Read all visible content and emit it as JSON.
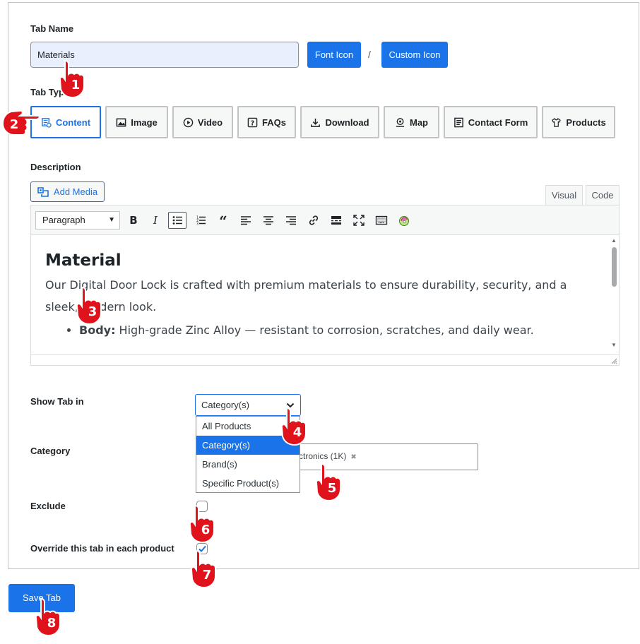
{
  "tab_name": {
    "label": "Tab Name",
    "value": "Materials",
    "font_icon_button": "Font Icon",
    "separator": "/",
    "custom_icon_button": "Custom Icon"
  },
  "tab_type": {
    "label": "Tab Type",
    "selected": "Content",
    "options": [
      {
        "label": "Content",
        "icon": "content-icon"
      },
      {
        "label": "Image",
        "icon": "image-icon"
      },
      {
        "label": "Video",
        "icon": "video-icon"
      },
      {
        "label": "FAQs",
        "icon": "faqs-icon"
      },
      {
        "label": "Download",
        "icon": "download-icon"
      },
      {
        "label": "Map",
        "icon": "map-icon"
      },
      {
        "label": "Contact Form",
        "icon": "contact-form-icon"
      },
      {
        "label": "Products",
        "icon": "products-icon"
      }
    ]
  },
  "description": {
    "label": "Description",
    "add_media": "Add Media",
    "tab_visual": "Visual",
    "tab_code": "Code",
    "format_select": "Paragraph",
    "heading": "Material",
    "paragraph": "Our Digital Door Lock is crafted with premium materials to ensure durability, security, and a sleek, modern look.",
    "bullet_bold": "Body:",
    "bullet_text": " High-grade Zinc Alloy — resistant to corrosion, scratches, and daily wear."
  },
  "show_tab_in": {
    "label": "Show Tab in",
    "value": "Category(s)",
    "options": [
      "All Products",
      "Category(s)",
      "Brand(s)",
      "Specific Product(s)"
    ]
  },
  "category": {
    "label": "Category",
    "chip": "ctronics (1K)"
  },
  "exclude": {
    "label": "Exclude",
    "checked": false
  },
  "override": {
    "label": "Override this tab in each product",
    "checked": true
  },
  "save_button": "Save Tab",
  "markers": [
    "1",
    "2",
    "3",
    "4",
    "5",
    "6",
    "7",
    "8"
  ],
  "colors": {
    "accent": "#1a73e8",
    "marker": "#e0121b"
  }
}
